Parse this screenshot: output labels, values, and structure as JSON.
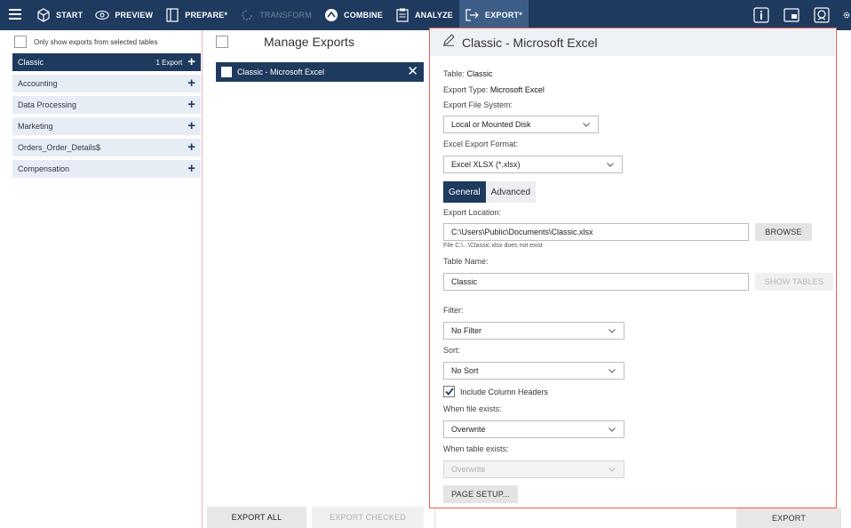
{
  "toolbar": {
    "items": [
      {
        "label": "START",
        "icon": "cube-icon",
        "state": "normal"
      },
      {
        "label": "PREVIEW",
        "icon": "eye-icon",
        "state": "normal"
      },
      {
        "label": "PREPARE*",
        "icon": "columns-icon",
        "state": "normal"
      },
      {
        "label": "TRANSFORM",
        "icon": "refresh-icon",
        "state": "disabled"
      },
      {
        "label": "COMBINE",
        "icon": "combine-icon",
        "state": "normal"
      },
      {
        "label": "ANALYZE",
        "icon": "clipboard-icon",
        "state": "normal"
      },
      {
        "label": "EXPORT*",
        "icon": "export-arrow-icon",
        "state": "active"
      }
    ],
    "right_icons": [
      "info-icon",
      "window-icon",
      "chat-icon",
      "gear-icon"
    ]
  },
  "left_pane": {
    "filter_label": "Only show exports from selected tables",
    "tables": [
      {
        "name": "Classic",
        "count": "1 Export",
        "selected": true
      },
      {
        "name": "Accounting",
        "count": "",
        "selected": false
      },
      {
        "name": "Data Processing",
        "count": "",
        "selected": false
      },
      {
        "name": "Marketing",
        "count": "",
        "selected": false
      },
      {
        "name": "Orders_Order_Details$",
        "count": "",
        "selected": false
      },
      {
        "name": "Compensation",
        "count": "",
        "selected": false
      }
    ]
  },
  "middle_pane": {
    "title": "Manage Exports",
    "export_item": "Classic - Microsoft Excel",
    "export_all_label": "EXPORT ALL",
    "export_checked_label": "EXPORT CHECKED"
  },
  "details": {
    "title": "Classic - Microsoft Excel",
    "table_label": "Table:",
    "table_value": "Classic",
    "export_type_label": "Export Type:",
    "export_type_value": "Microsoft Excel",
    "file_system_label": "Export File System:",
    "file_system_value": "Local or Mounted Disk",
    "excel_format_label": "Excel Export Format:",
    "excel_format_value": "Excel XLSX (*.xlsx)",
    "tab_general": "General",
    "tab_advanced": "Advanced",
    "location_label": "Export Location:",
    "location_value": "C:\\Users\\Public\\Documents\\Classic.xlsx",
    "browse_label": "BROWSE",
    "location_note": "File C:\\...\\Classic.xlsx does not exist",
    "table_name_label": "Table Name:",
    "table_name_value": "Classic",
    "show_tables_label": "SHOW TABLES",
    "filter_label": "Filter:",
    "filter_value": "No Filter",
    "sort_label": "Sort:",
    "sort_value": "No Sort",
    "include_headers_label": "Include Column Headers",
    "when_file_exists_label": "When file exists:",
    "when_file_exists_value": "Overwrite",
    "when_table_exists_label": "When table exists:",
    "when_table_exists_value": "Overwrite",
    "page_setup_label": "PAGE SETUP..."
  },
  "export_button_label": "EXPORT",
  "colors": {
    "toolbar_bg": "#1f3a5f",
    "active_tab": "#3d5e86",
    "selection": "#1f3a5f",
    "highlight_border": "#e8604c"
  }
}
